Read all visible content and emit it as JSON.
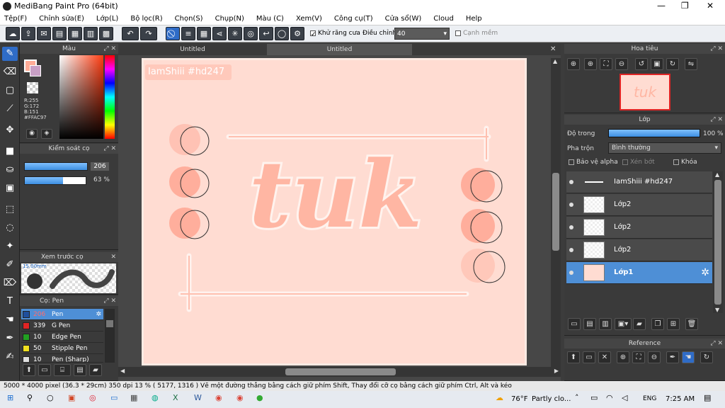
{
  "window": {
    "title": "MediBang Paint Pro (64bit)"
  },
  "menu": [
    "Tệp(F)",
    "Chỉnh sửa(E)",
    "Lớp(L)",
    "Bộ lọc(R)",
    "Chọn(S)",
    "Chụp(N)",
    "Màu (C)",
    "Xem(V)",
    "Công cụ(T)",
    "Cửa sổ(W)",
    "Cloud",
    "Help"
  ],
  "toolbar": {
    "antialias_label": "Khử răng cưa",
    "adjust_label": "Điều chỉnh",
    "adjust_value": "40",
    "soft_edge_label": "Cạnh mềm"
  },
  "color_panel": {
    "title": "Màu",
    "r": "R:255",
    "g": "G:172",
    "b": "B:151",
    "hex": "#FFAC97",
    "primary_color": "#FFAC97"
  },
  "brush_control": {
    "title": "Kiểm soát cọ",
    "size": "206",
    "opacity": "63 %",
    "opacity_fraction": 0.63
  },
  "brush_preview": {
    "title": "Xem trước cọ",
    "size_label": "15.00mm"
  },
  "brush_list": {
    "title": "Cọ: Pen",
    "items": [
      {
        "size": "206",
        "name": "Pen",
        "color": "#1f4f9c"
      },
      {
        "size": "339",
        "name": "G Pen",
        "color": "#e02424"
      },
      {
        "size": "10",
        "name": "Edge Pen",
        "color": "#22a022"
      },
      {
        "size": "50",
        "name": "Stipple Pen",
        "color": "#f0e020"
      },
      {
        "size": "10",
        "name": "Pen (Sharp)",
        "color": "#e0e0e0"
      }
    ]
  },
  "tabs": [
    "Untitled",
    "Untitled"
  ],
  "canvas": {
    "watermark": "IamShiii #hd247",
    "art_text": "tuk",
    "bg_color": "#ffdcd2"
  },
  "navigator": {
    "title": "Hoa tiêu"
  },
  "layer_panel": {
    "title": "Lớp",
    "opacity_label": "Độ trong",
    "opacity_value": "100 %",
    "opacity_fraction": 1.0,
    "blend_label": "Pha trộn",
    "blend_value": "Bình thường",
    "alpha_protect": "Bảo vệ alpha",
    "clip": "Xén bớt",
    "lock": "Khóa",
    "layers": [
      {
        "name": "IamShiii #hd247"
      },
      {
        "name": "Lớp2"
      },
      {
        "name": "Lớp2"
      },
      {
        "name": "Lớp2"
      },
      {
        "name": "Lớp1"
      }
    ]
  },
  "reference": {
    "title": "Reference"
  },
  "status": {
    "text": "5000 * 4000 pixel   (36.3 * 29cm)   350 dpi   13 %   ( 5177, 1316 )   Vẽ một đường thẳng bằng cách giữ phím Shift, Thay đổi cỡ cọ bằng cách giữ phím Ctrl, Alt và kéo"
  },
  "taskbar": {
    "weather_temp": "76°F",
    "weather_text": "Partly clo...",
    "lang": "ENG",
    "time": "7:25 AM"
  }
}
